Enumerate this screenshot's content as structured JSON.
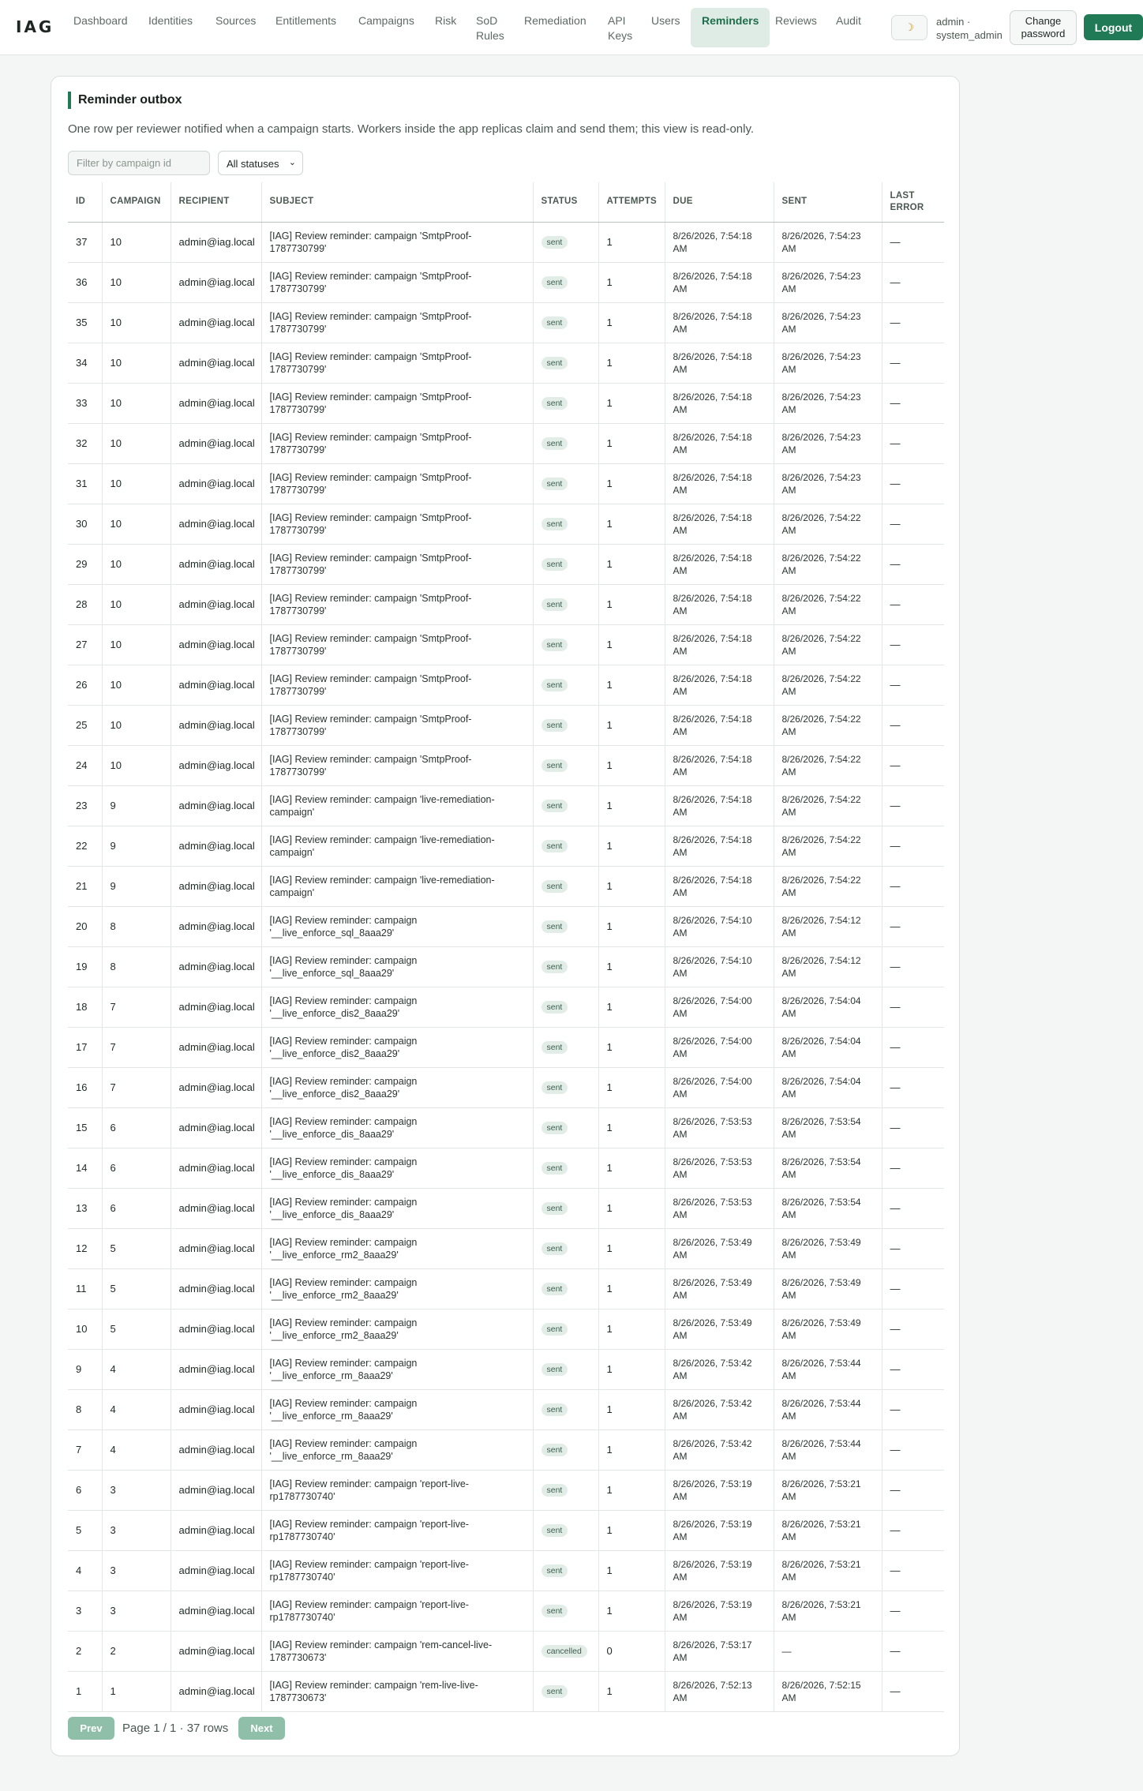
{
  "nav": {
    "brand": "IAG",
    "links": [
      {
        "label": "Dashboard"
      },
      {
        "label": "Identities"
      },
      {
        "label": "Sources"
      },
      {
        "label": "Entitlements"
      },
      {
        "label": "Campaigns"
      },
      {
        "label": "Risk"
      },
      {
        "label": "SoD Rules"
      },
      {
        "label": "Remediation"
      },
      {
        "label": "API Keys"
      },
      {
        "label": "Users"
      },
      {
        "label": "Reminders",
        "active": true
      },
      {
        "label": "Reviews"
      },
      {
        "label": "Audit"
      }
    ],
    "theme_toggle_icon": "moon-icon",
    "user_label": "admin · system_admin",
    "change_password_label": "Change password",
    "logout_label": "Logout"
  },
  "card": {
    "title": "Reminder outbox",
    "description": "One row per reviewer notified when a campaign starts. Workers inside the app replicas claim and send them; this view is read-only.",
    "filter_placeholder": "Filter by campaign id",
    "filter_value": "",
    "status_select_value": "All statuses"
  },
  "table": {
    "headers": [
      "ID",
      "CAMPAIGN",
      "RECIPIENT",
      "SUBJECT",
      "STATUS",
      "ATTEMPTS",
      "DUE",
      "SENT",
      "LAST ERROR"
    ],
    "rows": [
      {
        "id": "37",
        "campaign": "10",
        "recipient": "admin@iag.local",
        "subject": "[IAG] Review reminder: campaign 'SmtpProof-1787730799'",
        "status": "sent",
        "attempts": "1",
        "due": "8/26/2026, 7:54:18 AM",
        "sent": "8/26/2026, 7:54:23 AM",
        "last_error": "—"
      },
      {
        "id": "36",
        "campaign": "10",
        "recipient": "admin@iag.local",
        "subject": "[IAG] Review reminder: campaign 'SmtpProof-1787730799'",
        "status": "sent",
        "attempts": "1",
        "due": "8/26/2026, 7:54:18 AM",
        "sent": "8/26/2026, 7:54:23 AM",
        "last_error": "—"
      },
      {
        "id": "35",
        "campaign": "10",
        "recipient": "admin@iag.local",
        "subject": "[IAG] Review reminder: campaign 'SmtpProof-1787730799'",
        "status": "sent",
        "attempts": "1",
        "due": "8/26/2026, 7:54:18 AM",
        "sent": "8/26/2026, 7:54:23 AM",
        "last_error": "—"
      },
      {
        "id": "34",
        "campaign": "10",
        "recipient": "admin@iag.local",
        "subject": "[IAG] Review reminder: campaign 'SmtpProof-1787730799'",
        "status": "sent",
        "attempts": "1",
        "due": "8/26/2026, 7:54:18 AM",
        "sent": "8/26/2026, 7:54:23 AM",
        "last_error": "—"
      },
      {
        "id": "33",
        "campaign": "10",
        "recipient": "admin@iag.local",
        "subject": "[IAG] Review reminder: campaign 'SmtpProof-1787730799'",
        "status": "sent",
        "attempts": "1",
        "due": "8/26/2026, 7:54:18 AM",
        "sent": "8/26/2026, 7:54:23 AM",
        "last_error": "—"
      },
      {
        "id": "32",
        "campaign": "10",
        "recipient": "admin@iag.local",
        "subject": "[IAG] Review reminder: campaign 'SmtpProof-1787730799'",
        "status": "sent",
        "attempts": "1",
        "due": "8/26/2026, 7:54:18 AM",
        "sent": "8/26/2026, 7:54:23 AM",
        "last_error": "—"
      },
      {
        "id": "31",
        "campaign": "10",
        "recipient": "admin@iag.local",
        "subject": "[IAG] Review reminder: campaign 'SmtpProof-1787730799'",
        "status": "sent",
        "attempts": "1",
        "due": "8/26/2026, 7:54:18 AM",
        "sent": "8/26/2026, 7:54:23 AM",
        "last_error": "—"
      },
      {
        "id": "30",
        "campaign": "10",
        "recipient": "admin@iag.local",
        "subject": "[IAG] Review reminder: campaign 'SmtpProof-1787730799'",
        "status": "sent",
        "attempts": "1",
        "due": "8/26/2026, 7:54:18 AM",
        "sent": "8/26/2026, 7:54:22 AM",
        "last_error": "—"
      },
      {
        "id": "29",
        "campaign": "10",
        "recipient": "admin@iag.local",
        "subject": "[IAG] Review reminder: campaign 'SmtpProof-1787730799'",
        "status": "sent",
        "attempts": "1",
        "due": "8/26/2026, 7:54:18 AM",
        "sent": "8/26/2026, 7:54:22 AM",
        "last_error": "—"
      },
      {
        "id": "28",
        "campaign": "10",
        "recipient": "admin@iag.local",
        "subject": "[IAG] Review reminder: campaign 'SmtpProof-1787730799'",
        "status": "sent",
        "attempts": "1",
        "due": "8/26/2026, 7:54:18 AM",
        "sent": "8/26/2026, 7:54:22 AM",
        "last_error": "—"
      },
      {
        "id": "27",
        "campaign": "10",
        "recipient": "admin@iag.local",
        "subject": "[IAG] Review reminder: campaign 'SmtpProof-1787730799'",
        "status": "sent",
        "attempts": "1",
        "due": "8/26/2026, 7:54:18 AM",
        "sent": "8/26/2026, 7:54:22 AM",
        "last_error": "—"
      },
      {
        "id": "26",
        "campaign": "10",
        "recipient": "admin@iag.local",
        "subject": "[IAG] Review reminder: campaign 'SmtpProof-1787730799'",
        "status": "sent",
        "attempts": "1",
        "due": "8/26/2026, 7:54:18 AM",
        "sent": "8/26/2026, 7:54:22 AM",
        "last_error": "—"
      },
      {
        "id": "25",
        "campaign": "10",
        "recipient": "admin@iag.local",
        "subject": "[IAG] Review reminder: campaign 'SmtpProof-1787730799'",
        "status": "sent",
        "attempts": "1",
        "due": "8/26/2026, 7:54:18 AM",
        "sent": "8/26/2026, 7:54:22 AM",
        "last_error": "—"
      },
      {
        "id": "24",
        "campaign": "10",
        "recipient": "admin@iag.local",
        "subject": "[IAG] Review reminder: campaign 'SmtpProof-1787730799'",
        "status": "sent",
        "attempts": "1",
        "due": "8/26/2026, 7:54:18 AM",
        "sent": "8/26/2026, 7:54:22 AM",
        "last_error": "—"
      },
      {
        "id": "23",
        "campaign": "9",
        "recipient": "admin@iag.local",
        "subject": "[IAG] Review reminder: campaign 'live-remediation-campaign'",
        "status": "sent",
        "attempts": "1",
        "due": "8/26/2026, 7:54:18 AM",
        "sent": "8/26/2026, 7:54:22 AM",
        "last_error": "—"
      },
      {
        "id": "22",
        "campaign": "9",
        "recipient": "admin@iag.local",
        "subject": "[IAG] Review reminder: campaign 'live-remediation-campaign'",
        "status": "sent",
        "attempts": "1",
        "due": "8/26/2026, 7:54:18 AM",
        "sent": "8/26/2026, 7:54:22 AM",
        "last_error": "—"
      },
      {
        "id": "21",
        "campaign": "9",
        "recipient": "admin@iag.local",
        "subject": "[IAG] Review reminder: campaign 'live-remediation-campaign'",
        "status": "sent",
        "attempts": "1",
        "due": "8/26/2026, 7:54:18 AM",
        "sent": "8/26/2026, 7:54:22 AM",
        "last_error": "—"
      },
      {
        "id": "20",
        "campaign": "8",
        "recipient": "admin@iag.local",
        "subject": "[IAG] Review reminder: campaign '__live_enforce_sql_8aaa29'",
        "status": "sent",
        "attempts": "1",
        "due": "8/26/2026, 7:54:10 AM",
        "sent": "8/26/2026, 7:54:12 AM",
        "last_error": "—"
      },
      {
        "id": "19",
        "campaign": "8",
        "recipient": "admin@iag.local",
        "subject": "[IAG] Review reminder: campaign '__live_enforce_sql_8aaa29'",
        "status": "sent",
        "attempts": "1",
        "due": "8/26/2026, 7:54:10 AM",
        "sent": "8/26/2026, 7:54:12 AM",
        "last_error": "—"
      },
      {
        "id": "18",
        "campaign": "7",
        "recipient": "admin@iag.local",
        "subject": "[IAG] Review reminder: campaign '__live_enforce_dis2_8aaa29'",
        "status": "sent",
        "attempts": "1",
        "due": "8/26/2026, 7:54:00 AM",
        "sent": "8/26/2026, 7:54:04 AM",
        "last_error": "—"
      },
      {
        "id": "17",
        "campaign": "7",
        "recipient": "admin@iag.local",
        "subject": "[IAG] Review reminder: campaign '__live_enforce_dis2_8aaa29'",
        "status": "sent",
        "attempts": "1",
        "due": "8/26/2026, 7:54:00 AM",
        "sent": "8/26/2026, 7:54:04 AM",
        "last_error": "—"
      },
      {
        "id": "16",
        "campaign": "7",
        "recipient": "admin@iag.local",
        "subject": "[IAG] Review reminder: campaign '__live_enforce_dis2_8aaa29'",
        "status": "sent",
        "attempts": "1",
        "due": "8/26/2026, 7:54:00 AM",
        "sent": "8/26/2026, 7:54:04 AM",
        "last_error": "—"
      },
      {
        "id": "15",
        "campaign": "6",
        "recipient": "admin@iag.local",
        "subject": "[IAG] Review reminder: campaign '__live_enforce_dis_8aaa29'",
        "status": "sent",
        "attempts": "1",
        "due": "8/26/2026, 7:53:53 AM",
        "sent": "8/26/2026, 7:53:54 AM",
        "last_error": "—"
      },
      {
        "id": "14",
        "campaign": "6",
        "recipient": "admin@iag.local",
        "subject": "[IAG] Review reminder: campaign '__live_enforce_dis_8aaa29'",
        "status": "sent",
        "attempts": "1",
        "due": "8/26/2026, 7:53:53 AM",
        "sent": "8/26/2026, 7:53:54 AM",
        "last_error": "—"
      },
      {
        "id": "13",
        "campaign": "6",
        "recipient": "admin@iag.local",
        "subject": "[IAG] Review reminder: campaign '__live_enforce_dis_8aaa29'",
        "status": "sent",
        "attempts": "1",
        "due": "8/26/2026, 7:53:53 AM",
        "sent": "8/26/2026, 7:53:54 AM",
        "last_error": "—"
      },
      {
        "id": "12",
        "campaign": "5",
        "recipient": "admin@iag.local",
        "subject": "[IAG] Review reminder: campaign '__live_enforce_rm2_8aaa29'",
        "status": "sent",
        "attempts": "1",
        "due": "8/26/2026, 7:53:49 AM",
        "sent": "8/26/2026, 7:53:49 AM",
        "last_error": "—"
      },
      {
        "id": "11",
        "campaign": "5",
        "recipient": "admin@iag.local",
        "subject": "[IAG] Review reminder: campaign '__live_enforce_rm2_8aaa29'",
        "status": "sent",
        "attempts": "1",
        "due": "8/26/2026, 7:53:49 AM",
        "sent": "8/26/2026, 7:53:49 AM",
        "last_error": "—"
      },
      {
        "id": "10",
        "campaign": "5",
        "recipient": "admin@iag.local",
        "subject": "[IAG] Review reminder: campaign '__live_enforce_rm2_8aaa29'",
        "status": "sent",
        "attempts": "1",
        "due": "8/26/2026, 7:53:49 AM",
        "sent": "8/26/2026, 7:53:49 AM",
        "last_error": "—"
      },
      {
        "id": "9",
        "campaign": "4",
        "recipient": "admin@iag.local",
        "subject": "[IAG] Review reminder: campaign '__live_enforce_rm_8aaa29'",
        "status": "sent",
        "attempts": "1",
        "due": "8/26/2026, 7:53:42 AM",
        "sent": "8/26/2026, 7:53:44 AM",
        "last_error": "—"
      },
      {
        "id": "8",
        "campaign": "4",
        "recipient": "admin@iag.local",
        "subject": "[IAG] Review reminder: campaign '__live_enforce_rm_8aaa29'",
        "status": "sent",
        "attempts": "1",
        "due": "8/26/2026, 7:53:42 AM",
        "sent": "8/26/2026, 7:53:44 AM",
        "last_error": "—"
      },
      {
        "id": "7",
        "campaign": "4",
        "recipient": "admin@iag.local",
        "subject": "[IAG] Review reminder: campaign '__live_enforce_rm_8aaa29'",
        "status": "sent",
        "attempts": "1",
        "due": "8/26/2026, 7:53:42 AM",
        "sent": "8/26/2026, 7:53:44 AM",
        "last_error": "—"
      },
      {
        "id": "6",
        "campaign": "3",
        "recipient": "admin@iag.local",
        "subject": "[IAG] Review reminder: campaign 'report-live-rp1787730740'",
        "status": "sent",
        "attempts": "1",
        "due": "8/26/2026, 7:53:19 AM",
        "sent": "8/26/2026, 7:53:21 AM",
        "last_error": "—"
      },
      {
        "id": "5",
        "campaign": "3",
        "recipient": "admin@iag.local",
        "subject": "[IAG] Review reminder: campaign 'report-live-rp1787730740'",
        "status": "sent",
        "attempts": "1",
        "due": "8/26/2026, 7:53:19 AM",
        "sent": "8/26/2026, 7:53:21 AM",
        "last_error": "—"
      },
      {
        "id": "4",
        "campaign": "3",
        "recipient": "admin@iag.local",
        "subject": "[IAG] Review reminder: campaign 'report-live-rp1787730740'",
        "status": "sent",
        "attempts": "1",
        "due": "8/26/2026, 7:53:19 AM",
        "sent": "8/26/2026, 7:53:21 AM",
        "last_error": "—"
      },
      {
        "id": "3",
        "campaign": "3",
        "recipient": "admin@iag.local",
        "subject": "[IAG] Review reminder: campaign 'report-live-rp1787730740'",
        "status": "sent",
        "attempts": "1",
        "due": "8/26/2026, 7:53:19 AM",
        "sent": "8/26/2026, 7:53:21 AM",
        "last_error": "—"
      },
      {
        "id": "2",
        "campaign": "2",
        "recipient": "admin@iag.local",
        "subject": "[IAG] Review reminder: campaign 'rem-cancel-live-1787730673'",
        "status": "cancelled",
        "attempts": "0",
        "due": "8/26/2026, 7:53:17 AM",
        "sent": "—",
        "last_error": "—"
      },
      {
        "id": "1",
        "campaign": "1",
        "recipient": "admin@iag.local",
        "subject": "[IAG] Review reminder: campaign 'rem-live-live-1787730673'",
        "status": "sent",
        "attempts": "1",
        "due": "8/26/2026, 7:52:13 AM",
        "sent": "8/26/2026, 7:52:15 AM",
        "last_error": "—"
      }
    ]
  },
  "pager": {
    "prev_label": "Prev",
    "info": "Page 1 / 1 · 37 rows",
    "next_label": "Next"
  }
}
